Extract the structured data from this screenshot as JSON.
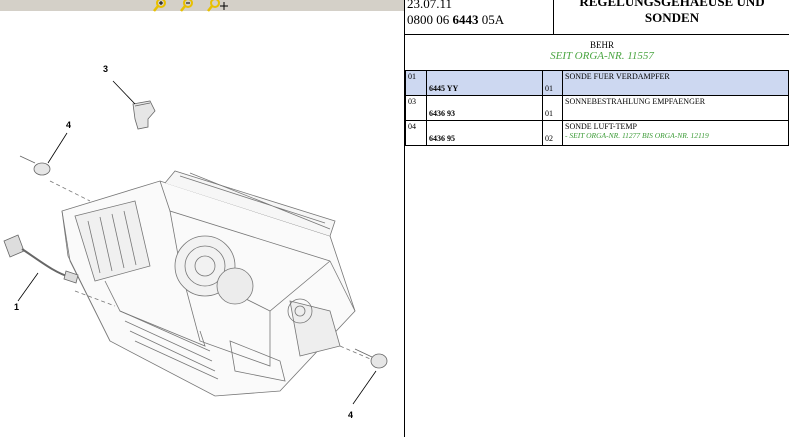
{
  "toolbar": {
    "buttons": [
      {
        "name": "zoom-in-button",
        "icon": "zoom-in-icon"
      },
      {
        "name": "zoom-out-button",
        "icon": "zoom-out-icon"
      },
      {
        "name": "pan-zoom-button",
        "icon": "pan-zoom-icon"
      }
    ],
    "colors": {
      "bar": "#d4d0c8",
      "icon": "#e8c000"
    }
  },
  "diagram": {
    "callouts": [
      "3",
      "4",
      "1",
      "4"
    ]
  },
  "header": {
    "date": "23.07.11",
    "code_prefix": "0800 06 ",
    "code_bold": "6443",
    "code_suffix": " 05A",
    "title_line1": "REGELUNGSGEHAEUSE UND",
    "title_line2": "SONDEN"
  },
  "supplier": {
    "name": "BEHR",
    "note": "SEIT ORGA-NR. 11557"
  },
  "parts": [
    {
      "pos": "01",
      "ref": "6445 YY",
      "qty": "01",
      "desc": "SONDE FUER VERDAMPFER",
      "note": "",
      "selected": true
    },
    {
      "pos": "03",
      "ref": "6436 93",
      "qty": "01",
      "desc": "SONNEBESTRAHLUNG EMPFAENGER",
      "note": "",
      "selected": false
    },
    {
      "pos": "04",
      "ref": "6436 95",
      "qty": "02",
      "desc": "SONDE LUFT-TEMP",
      "note": "- SEIT ORGA-NR. 11277 BIS ORGA-NR. 12119",
      "selected": false
    }
  ],
  "colors": {
    "selected_row": "#cdd8f1",
    "note_green": "#4aa541"
  }
}
